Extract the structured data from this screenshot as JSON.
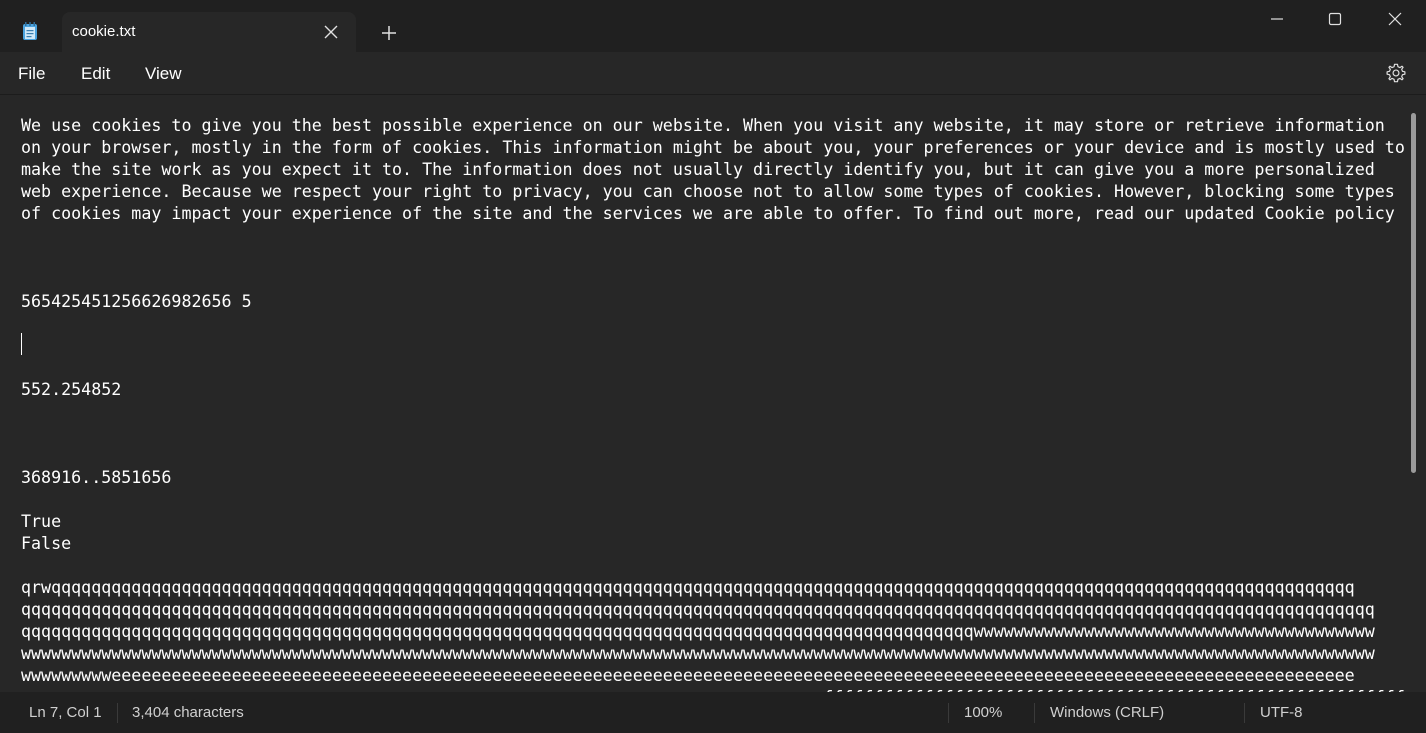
{
  "tab": {
    "title": "cookie.txt",
    "icon": "notepad-icon"
  },
  "menu": {
    "file": "File",
    "edit": "Edit",
    "view": "View"
  },
  "editor": {
    "content": "We use cookies to give you the best possible experience on our website. When you visit any website, it may store or retrieve information\non your browser, mostly in the form of cookies. This information might be about you, your preferences or your device and is mostly used to\nmake the site work as you expect it to. The information does not usually directly identify you, but it can give you a more personalized\nweb experience. Because we respect your right to privacy, you can choose not to allow some types of cookies. However, blocking some types\nof cookies may impact your experience of the site and the services we are able to offer. To find out more, read our updated Cookie policy\n\n\n\n565425451256626982656 5\n\n\n\n552.254852\n\n\n\n368916..5851656\n\nTrue\nFalse\n\nqrwqqqqqqqqqqqqqqqqqqqqqqqqqqqqqqqqqqqqqqqqqqqqqqqqqqqqqqqqqqqqqqqqqqqqqqqqqqqqqqqqqqqqqqqqqqqqqqqqqqqqqqqqqqqqqqqqqqqqqqqqqqqqqqqqqq\nqqqqqqqqqqqqqqqqqqqqqqqqqqqqqqqqqqqqqqqqqqqqqqqqqqqqqqqqqqqqqqqqqqqqqqqqqqqqqqqqqqqqqqqqqqqqqqqqqqqqqqqqqqqqqqqqqqqqqqqqqqqqqqqqqqqqqqq\nqqqqqqqqqqqqqqqqqqqqqqqqqqqqqqqqqqqqqqqqqqqqqqqqqqqqqqqqqqqqqqqqqqqqqqqqqqqqqqqqqqqqqqqqqqqqqqqwwwwwwwwwwwwwwwwwwwwwwwwwwwwwwwwwwwwwwww\nwwwwwwwwwwwwwwwwwwwwwwwwwwwwwwwwwwwwwwwwwwwwwwwwwwwwwwwwwwwwwwwwwwwwwwwwwwwwwwwwwwwwwwwwwwwwwwwwwwwwwwwwwwwwwwwwwwwwwwwwwwwwwwwwwwwwwww\nwwwwwwwwweeeeeeeeeeeeeeeeeeeeeeeeeeeeeeeeeeeeeeeeeeeeeeeeeeeeeeeeeeeeeeeeeeeeeeeeeeeeeeeeeeeeeeeeeeeeeeeeeeeeeeeeeeeeeeeeeeeeeeeeeeee\n                                                                                ffffffffffffffffffffffffffffffffffffffffffffffffffffffffffff"
  },
  "status": {
    "position": "Ln 7, Col 1",
    "characters": "3,404 characters",
    "zoom": "100%",
    "line_ending": "Windows (CRLF)",
    "encoding": "UTF-8"
  }
}
